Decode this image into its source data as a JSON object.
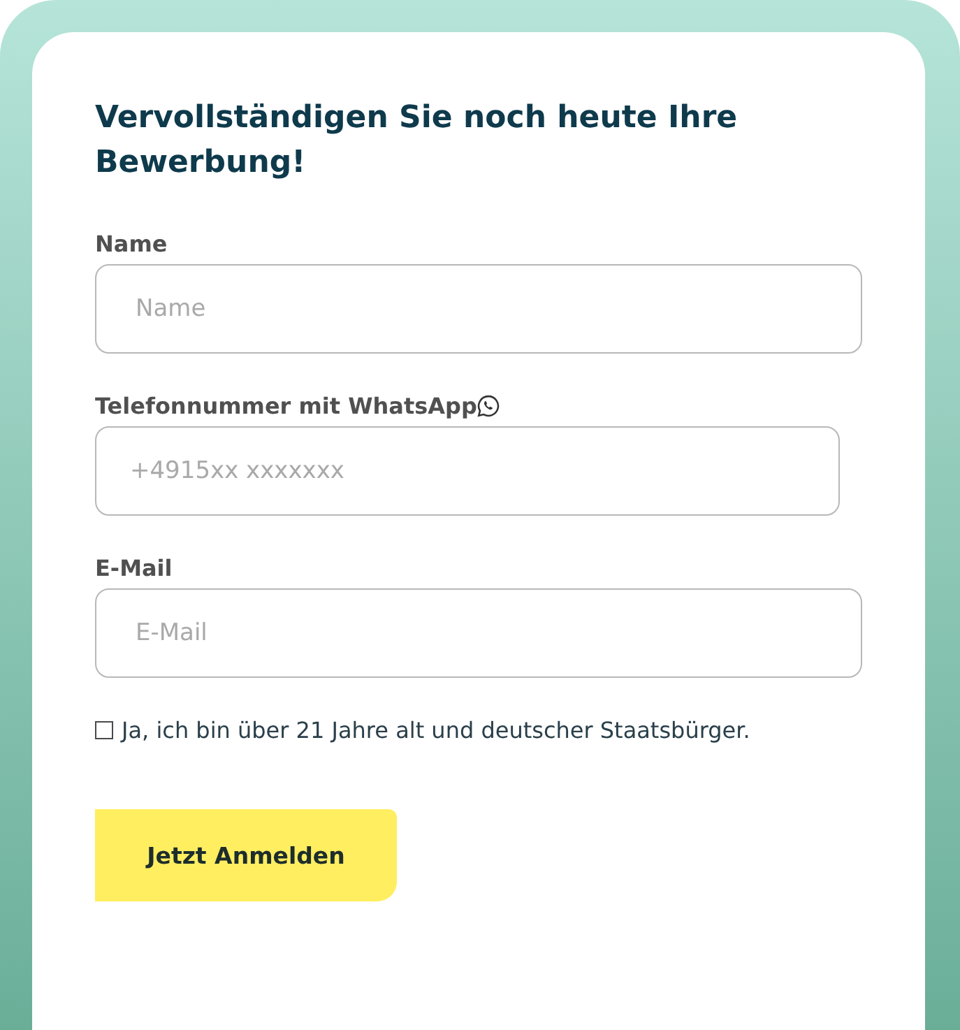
{
  "form": {
    "title": "Vervollständigen Sie noch heute Ihre Bewerbung!",
    "fields": [
      {
        "kind": "text",
        "label": "Name",
        "placeholder": "Name"
      },
      {
        "kind": "phone",
        "label": "Telefonnummer mit WhatsApp",
        "placeholder": "+4915xx xxxxxxx"
      },
      {
        "kind": "text",
        "label": "E-Mail",
        "placeholder": "E-Mail"
      }
    ],
    "consent": {
      "label": "Ja, ich bin über 21 Jahre alt und deutscher Staatsbürger.",
      "checked": false
    },
    "submit": "Jetzt Anmelden"
  }
}
